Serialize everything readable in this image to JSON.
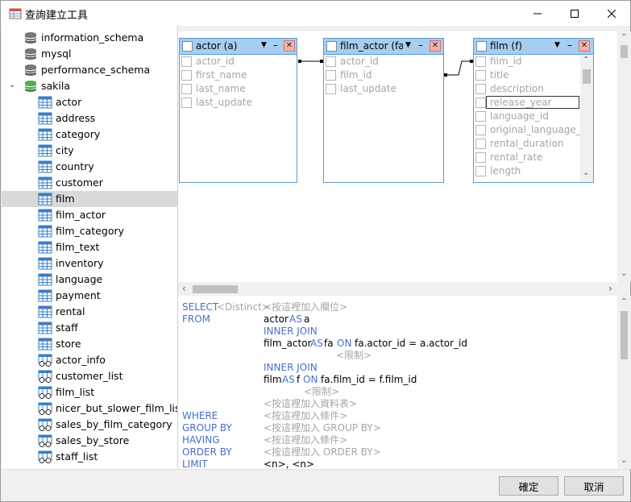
{
  "window": {
    "title": "查詢建立工具"
  },
  "tree": {
    "databases": [
      {
        "name": "information_schema"
      },
      {
        "name": "mysql"
      },
      {
        "name": "performance_schema"
      },
      {
        "name": "sakila",
        "expanded": true
      }
    ],
    "tables": [
      "actor",
      "address",
      "category",
      "city",
      "country",
      "customer",
      "film",
      "film_actor",
      "film_category",
      "film_text",
      "inventory",
      "language",
      "payment",
      "rental",
      "staff",
      "store"
    ],
    "views": [
      "actor_info",
      "customer_list",
      "film_list",
      "nicer_but_slower_film_list",
      "sales_by_film_category",
      "sales_by_store",
      "staff_list"
    ],
    "selected": "film"
  },
  "design": {
    "tables": [
      {
        "title": "actor (a)",
        "fields": [
          "actor_id",
          "first_name",
          "last_name",
          "last_update"
        ]
      },
      {
        "title": "film_actor (fa)",
        "fields": [
          "actor_id",
          "film_id",
          "last_update"
        ]
      },
      {
        "title": "film (f)",
        "fields": [
          "film_id",
          "title",
          "description",
          "release_year",
          "language_id",
          "original_language_id",
          "rental_duration",
          "rental_rate",
          "length"
        ],
        "focused": "release_year"
      }
    ]
  },
  "sql": {
    "select_kw": "SELECT",
    "distinct": "<Distinct>",
    "add_field": "<按這裡加入欄位>",
    "from_kw": "FROM",
    "t1": "actor",
    "as_kw": "AS",
    "t1_alias": "a",
    "inner_join": "INNER JOIN",
    "t2": "film_actor",
    "t2_alias": "fa",
    "on_kw": "ON",
    "cond1": "fa.actor_id = a.actor_id",
    "limit_hint": "<限制>",
    "t3": "film",
    "t3_alias": "f",
    "cond2": "fa.film_id = f.film_id",
    "add_table": "<按這裡加入資料表>",
    "where_kw": "WHERE",
    "add_condition": "<按這裡加入條件>",
    "groupby_kw": "GROUP BY",
    "add_groupby": "<按這裡加入 GROUP BY>",
    "having_kw": "HAVING",
    "orderby_kw": "ORDER BY",
    "add_orderby": "<按這裡加入 ORDER BY>",
    "limit_kw": "LIMIT",
    "limit_values": "<n>, <n>"
  },
  "buttons": {
    "ok": "確定",
    "cancel": "取消"
  }
}
